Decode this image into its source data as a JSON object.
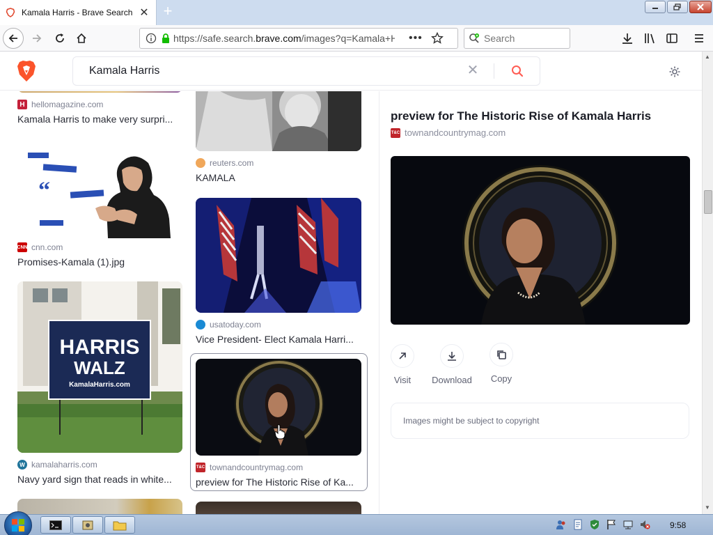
{
  "browser": {
    "tab_title": "Kamala Harris - Brave Search",
    "url_prefix": "https://safe.search.",
    "url_domain": "brave.com",
    "url_path": "/images?q=Kamala+H",
    "search_placeholder": "Search"
  },
  "search": {
    "query": "Kamala Harris"
  },
  "results": [
    {
      "source": "hellomagazine.com",
      "caption": "Kamala Harris to make very surpri..."
    },
    {
      "source": "cnn.com",
      "caption": "Promises-Kamala (1).jpg"
    },
    {
      "source": "kamalaharris.com",
      "caption": "Navy yard sign that reads in white..."
    },
    {
      "source": "reuters.com",
      "caption": "KAMALA"
    },
    {
      "source": "usatoday.com",
      "caption": "Vice President- Elect Kamala Harri..."
    },
    {
      "source": "townandcountrymag.com",
      "caption": "preview for The Historic Rise of Ka..."
    }
  ],
  "sign": {
    "line1": "HARRIS",
    "line2": "WALZ",
    "line3": "KamalaHarris.com"
  },
  "preview": {
    "title": "preview for The Historic Rise of Kamala Harris",
    "source": "townandcountrymag.com",
    "actions": {
      "visit": "Visit",
      "download": "Download",
      "copy": "Copy"
    },
    "copyright": "Images might be subject to copyright"
  },
  "taskbar": {
    "clock": "9:58"
  },
  "colors": {
    "brave_orange": "#fb542b",
    "search_icon": "#ff5c53",
    "taskbar": "#a9bfdb"
  }
}
